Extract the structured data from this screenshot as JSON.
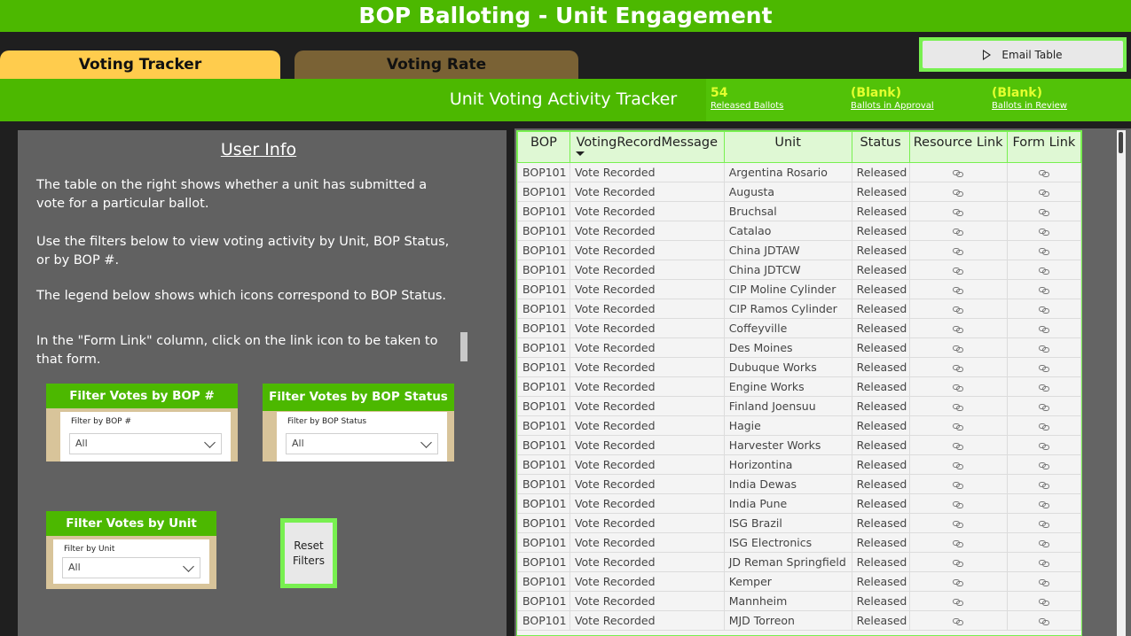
{
  "app": {
    "title": "BOP Balloting - Unit Engagement"
  },
  "tabs": [
    {
      "label": "Voting Tracker",
      "active": true
    },
    {
      "label": "Voting Rate",
      "active": false
    }
  ],
  "toolbar": {
    "email_label": "Email Table",
    "email_icon": "play-icon"
  },
  "tracker": {
    "title": "Unit Voting Activity Tracker",
    "kpis": [
      {
        "value": "54",
        "label": "Released Ballots"
      },
      {
        "value": "(Blank)",
        "label": "Ballots in Approval"
      },
      {
        "value": "(Blank)",
        "label": "Ballots in Review"
      }
    ]
  },
  "user_info": {
    "heading": "User Info",
    "paragraphs": [
      "The table on the right shows whether a unit has submitted a vote for a particular ballot.",
      "Use the filters below to view voting activity by Unit, BOP Status, or by BOP #.",
      "The legend below shows which icons correspond to BOP Status.",
      "In the \"Form Link\" column, click on the link icon to be taken to that form."
    ]
  },
  "filters": {
    "bop_number": {
      "header": "Filter Votes by BOP #",
      "label": "Filter by BOP #",
      "value": "All"
    },
    "bop_status": {
      "header": "Filter Votes by BOP Status",
      "label": "Filter by BOP Status",
      "value": "All"
    },
    "unit": {
      "header": "Filter Votes by Unit",
      "label": "Filter by Unit",
      "value": "All"
    }
  },
  "reset": {
    "line1": "Reset",
    "line2": "Filters"
  },
  "table": {
    "columns": [
      "BOP",
      "VotingRecordMessage",
      "Unit",
      "Status",
      "Resource Link",
      "Form Link"
    ],
    "link_icon": "link-icon",
    "rows": [
      [
        "BOP101",
        "Vote Recorded",
        "Argentina Rosario",
        "Released"
      ],
      [
        "BOP101",
        "Vote Recorded",
        "Augusta",
        "Released"
      ],
      [
        "BOP101",
        "Vote Recorded",
        "Bruchsal",
        "Released"
      ],
      [
        "BOP101",
        "Vote Recorded",
        "Catalao",
        "Released"
      ],
      [
        "BOP101",
        "Vote Recorded",
        "China JDTAW",
        "Released"
      ],
      [
        "BOP101",
        "Vote Recorded",
        "China JDTCW",
        "Released"
      ],
      [
        "BOP101",
        "Vote Recorded",
        "CIP Moline Cylinder",
        "Released"
      ],
      [
        "BOP101",
        "Vote Recorded",
        "CIP Ramos Cylinder",
        "Released"
      ],
      [
        "BOP101",
        "Vote Recorded",
        "Coffeyville",
        "Released"
      ],
      [
        "BOP101",
        "Vote Recorded",
        "Des Moines",
        "Released"
      ],
      [
        "BOP101",
        "Vote Recorded",
        "Dubuque Works",
        "Released"
      ],
      [
        "BOP101",
        "Vote Recorded",
        "Engine Works",
        "Released"
      ],
      [
        "BOP101",
        "Vote Recorded",
        "Finland Joensuu",
        "Released"
      ],
      [
        "BOP101",
        "Vote Recorded",
        "Hagie",
        "Released"
      ],
      [
        "BOP101",
        "Vote Recorded",
        "Harvester Works",
        "Released"
      ],
      [
        "BOP101",
        "Vote Recorded",
        "Horizontina",
        "Released"
      ],
      [
        "BOP101",
        "Vote Recorded",
        "India Dewas",
        "Released"
      ],
      [
        "BOP101",
        "Vote Recorded",
        "India Pune",
        "Released"
      ],
      [
        "BOP101",
        "Vote Recorded",
        "ISG Brazil",
        "Released"
      ],
      [
        "BOP101",
        "Vote Recorded",
        "ISG Electronics",
        "Released"
      ],
      [
        "BOP101",
        "Vote Recorded",
        "JD Reman Springfield",
        "Released"
      ],
      [
        "BOP101",
        "Vote Recorded",
        "Kemper",
        "Released"
      ],
      [
        "BOP101",
        "Vote Recorded",
        "Mannheim",
        "Released"
      ],
      [
        "BOP101",
        "Vote Recorded",
        "MJD Torreon",
        "Released"
      ]
    ]
  }
}
